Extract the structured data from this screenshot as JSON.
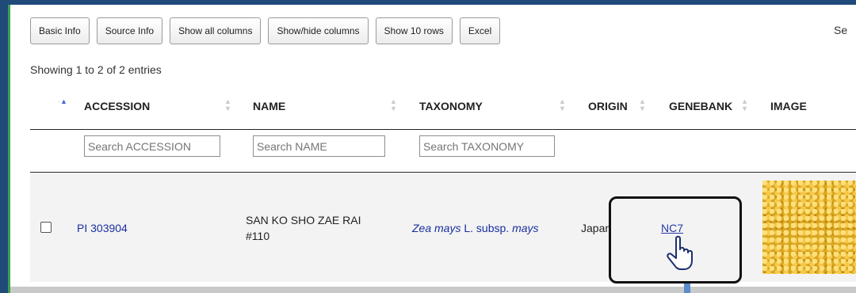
{
  "toolbar": {
    "buttons": [
      "Basic Info",
      "Source Info",
      "Show all columns",
      "Show/hide columns",
      "Show 10 rows",
      "Excel"
    ],
    "search_label": "Se"
  },
  "table_info": "Showing 1 to 2 of 2 entries",
  "columns": [
    "ACCESSION",
    "NAME",
    "TAXONOMY",
    "ORIGIN",
    "GENEBANK",
    "IMAGE"
  ],
  "column_search": {
    "accession_placeholder": "Search ACCESSION",
    "name_placeholder": "Search NAME",
    "taxonomy_placeholder": "Search TAXONOMY"
  },
  "rows": [
    {
      "accession": "PI 303904",
      "name": "SAN KO SHO ZAE RAI #110",
      "taxonomy": {
        "genus_species": "Zea mays",
        "author": " L. subsp. ",
        "subspecies": "mays"
      },
      "origin": "Japan",
      "genebank": "NC7",
      "image": "corn kernels"
    }
  ],
  "colors": {
    "link": "#1a2fa0",
    "frame": "#1f4a7a",
    "accent": "#3aa24f"
  },
  "icons": [
    "sort-icon",
    "hand-pointer-icon"
  ]
}
